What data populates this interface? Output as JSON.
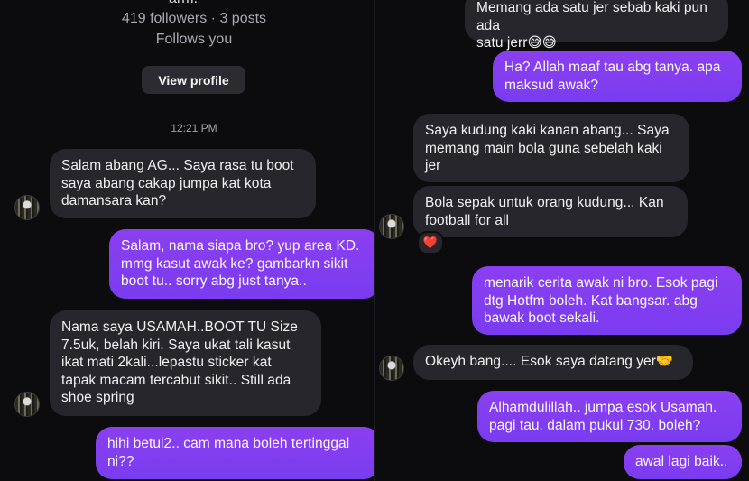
{
  "profile": {
    "handle": "arm._",
    "stats": "419 followers · 3 posts",
    "follows": "Follows you",
    "view_profile_label": "View profile"
  },
  "timestamp": "12:21 PM",
  "left_messages": [
    {
      "text": "Salam abang AG... Saya rasa tu boot\nsaya abang cakap jumpa kat kota\ndamansara kan?"
    },
    {
      "text": "Salam, nama siapa bro? yup area KD.\nmmg kasut awak ke? gambarkn sikit\nboot tu.. sorry abg just tanya.."
    },
    {
      "text": "Nama saya USAMAH..BOOT TU Size\n7.5uk, belah kiri. Saya ukat tali kasut\nikat mati 2kali...lepastu sticker kat\ntapak macam tercabut sikit.. Still ada\nshoe spring"
    },
    {
      "text": "hihi betul2.. cam mana boleh tertinggal\nni??"
    }
  ],
  "right_messages": [
    {
      "text": "Memang ada satu jer sebab kaki pun ada\nsatu jerr😅😅"
    },
    {
      "text": "Ha? Allah maaf tau abg tanya. apa\nmaksud awak?"
    },
    {
      "text": "Saya kudung kaki kanan abang... Saya\nmemang main bola guna sebelah kaki\njer"
    },
    {
      "text": "Bola sepak untuk orang kudung... Kan\nfootball for all"
    },
    {
      "text": "menarik cerita awak ni bro. Esok pagi\ndtg Hotfm boleh. Kat bangsar. abg\nbawak boot sekali."
    },
    {
      "text": "Okeyh bang.... Esok saya datang yer🤝"
    },
    {
      "text": "Alhamdulillah.. jumpa esok Usamah.\npagi tau. dalam pukul 730. boleh?"
    },
    {
      "text": "awal lagi baik.."
    }
  ],
  "reaction": "❤️",
  "colors": {
    "background": "#0c0c0e",
    "incoming_bubble": "#26262c",
    "outgoing_bubble": "#7a3cf0",
    "profile_button": "#2b2b31"
  }
}
